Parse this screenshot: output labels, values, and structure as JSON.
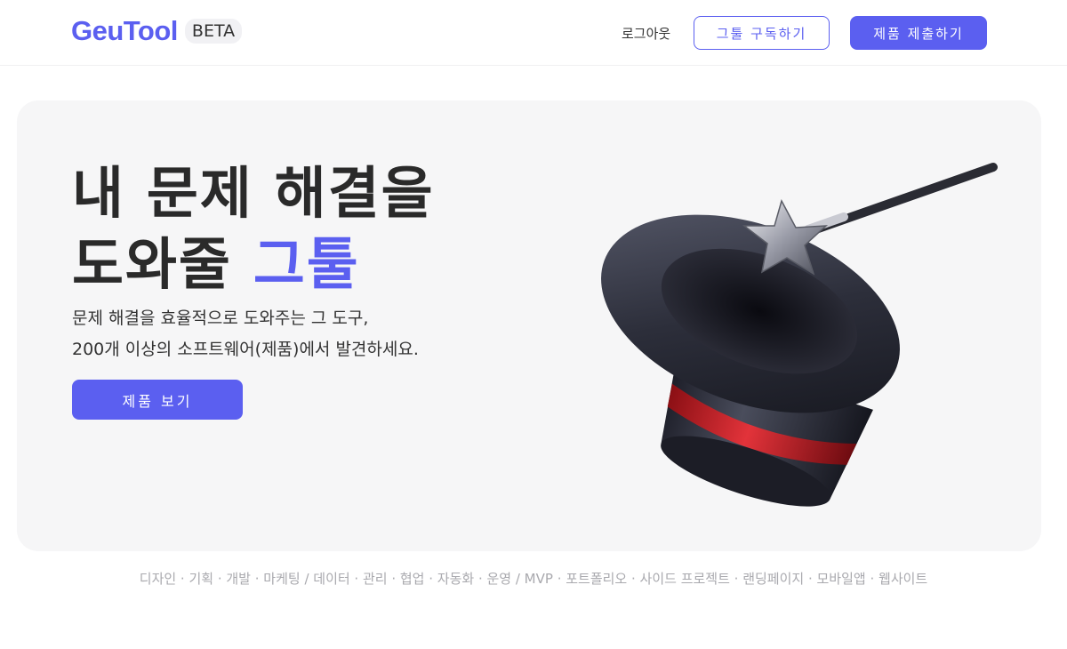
{
  "header": {
    "logo": "GeuTool",
    "badge": "BETA",
    "logout": "로그아웃",
    "subscribe_button": "그툴 구독하기",
    "submit_button": "제품 제출하기"
  },
  "hero": {
    "title_line1": "내 문제 해결을",
    "title_line2_prefix": "도와줄 ",
    "title_line2_accent": "그툴",
    "subtitle_line1": "문제 해결을 효율적으로 도와주는 그 도구,",
    "subtitle_line2": "200개 이상의 소프트웨어(제품)에서 발견하세요.",
    "cta_button": "제품 보기",
    "illustration": "magic-hat-wand-icon"
  },
  "tags": "디자인 · 기획 · 개발 · 마케팅 / 데이터 · 관리 · 협업 · 자동화 · 운영 /  MVP · 포트폴리오 · 사이드 프로젝트 · 랜딩페이지 · 모바일앱 · 웹사이트",
  "colors": {
    "accent": "#5b5ff0",
    "hero_bg": "#f6f6f7",
    "tag_text": "#a9a9ae"
  }
}
